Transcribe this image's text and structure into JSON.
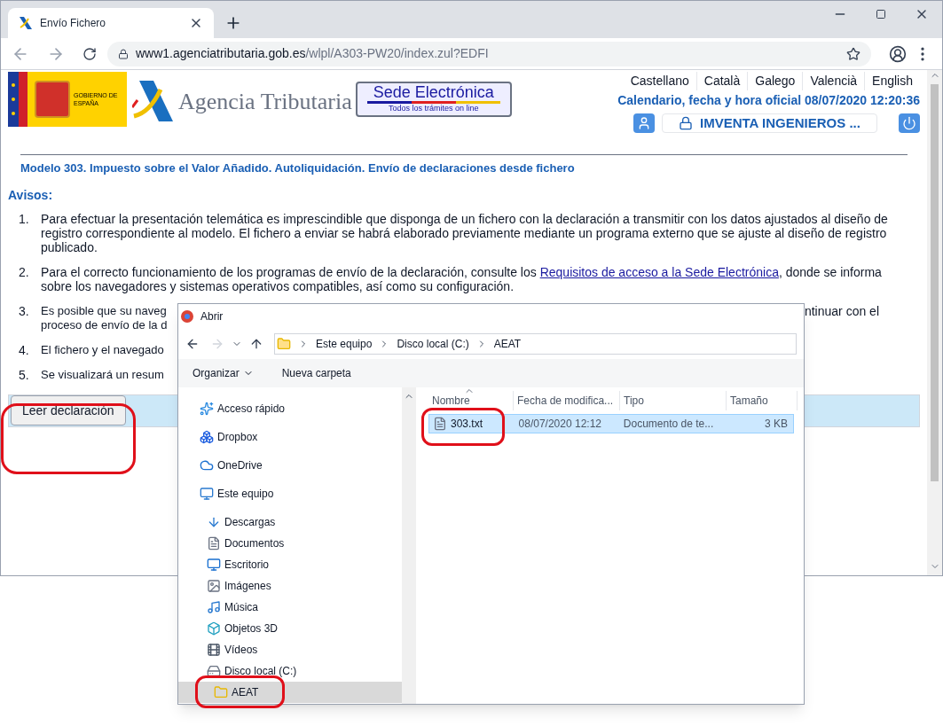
{
  "browser": {
    "tab_title": "Envío Fichero",
    "url_host": "www1.agenciatributaria.gob.es",
    "url_path": "/wlpl/A303-PW20/index.zul?EDFI"
  },
  "header": {
    "government": "GOBIERNO DE ESPAÑA",
    "agency": "Agencia Tributaria",
    "sede_title": "Sede Electrónica",
    "sede_subtitle": "Todos los trámites on line",
    "languages": [
      "Castellano",
      "Català",
      "Galego",
      "Valencià",
      "English"
    ],
    "official_time": "Calendario, fecha y hora oficial 08/07/2020 12:20:36",
    "user": "IMVENTA INGENIEROS ..."
  },
  "page": {
    "title": "Modelo 303. Impuesto sobre el Valor Añadido. Autoliquidación. Envío de declaraciones desde fichero",
    "notices_heading": "Avisos:",
    "notices": [
      {
        "kind": "paragraph",
        "number": "1.",
        "text": "Para efectuar la presentación telemática es imprescindible que disponga de un fichero con la declaración a transmitir con los datos ajustados al diseño de registro correspondiente al modelo. El fichero a enviar se habrá elaborado previamente mediante un programa externo que se ajuste al diseño de registro publicado."
      },
      {
        "kind": "linked",
        "number": "2.",
        "text_before": "Para el correcto funcionamiento de los programas de envío de la declaración, consulte los ",
        "link": "Requisitos de acceso a la Sede Electrónica",
        "text_after": ", donde se informa sobre los navegadores y sistemas operativos compatibles, así como su configuración."
      },
      {
        "kind": "fragments",
        "number": "3.",
        "lines": [
          {
            "left": "Es posible que su naveg",
            "right": "ntinuar con el"
          },
          {
            "left": "proceso de envío de la d"
          }
        ]
      },
      {
        "kind": "fragments",
        "number": "4.",
        "lines": [
          {
            "left": "El fichero y el navegado"
          }
        ]
      },
      {
        "kind": "fragments",
        "number": "5.",
        "lines": [
          {
            "left": "Se visualizará un resum"
          }
        ]
      }
    ],
    "read_button": "Leer declaración"
  },
  "dialog": {
    "title": "Abrir",
    "path": [
      "Este equipo",
      "Disco local (C:)",
      "AEAT"
    ],
    "toolbar": [
      "Organizar",
      "Nueva carpeta"
    ],
    "nav": [
      {
        "label": "Acceso rápido",
        "selected": false
      },
      {
        "label": "Dropbox",
        "selected": false
      },
      {
        "label": "OneDrive",
        "selected": false
      },
      {
        "label": "Este equipo",
        "selected": false,
        "children": [
          {
            "label": "Descargas",
            "selected": false
          },
          {
            "label": "Documentos",
            "selected": false
          },
          {
            "label": "Escritorio",
            "selected": false
          },
          {
            "label": "Imágenes",
            "selected": false
          },
          {
            "label": "Música",
            "selected": false
          },
          {
            "label": "Objetos 3D",
            "selected": false
          },
          {
            "label": "Vídeos",
            "selected": false
          },
          {
            "label": "Disco local (C:)",
            "selected": false,
            "children": [
              {
                "label": "AEAT",
                "selected": true
              }
            ]
          }
        ]
      }
    ],
    "columns": [
      "Nombre",
      "Fecha de modifica...",
      "Tipo",
      "Tamaño"
    ],
    "files": [
      {
        "name": "303.txt",
        "date": "08/07/2020 12:12",
        "type": "Documento de te...",
        "size": "3 KB",
        "selected": true
      }
    ]
  }
}
